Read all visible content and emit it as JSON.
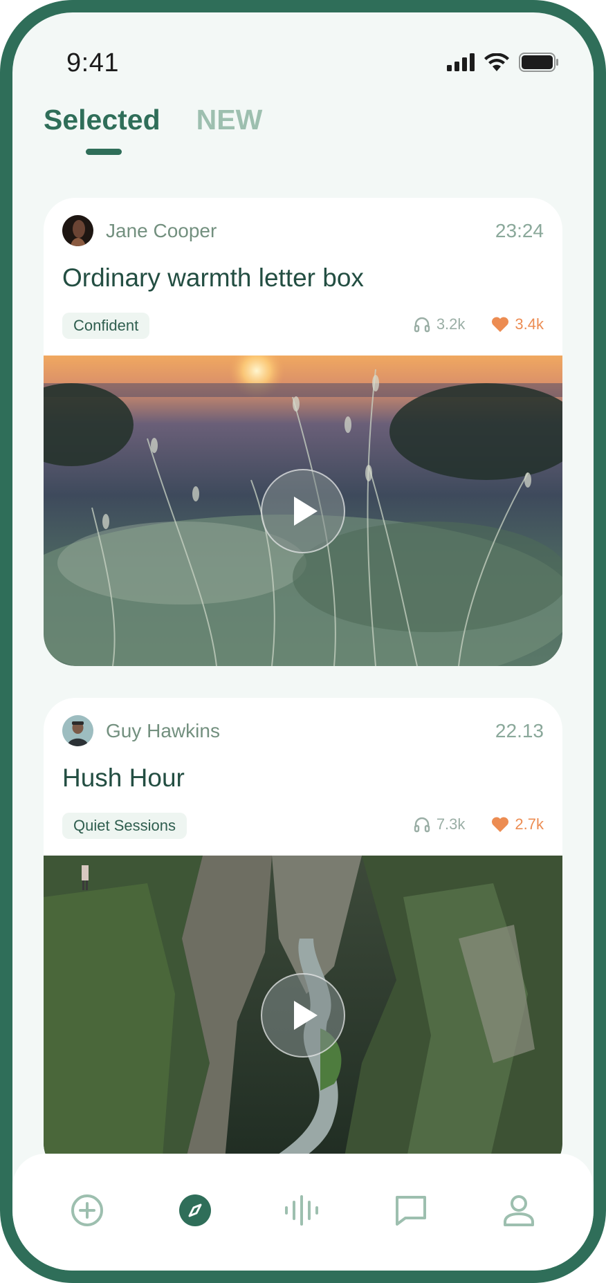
{
  "status_bar": {
    "time": "9:41"
  },
  "tabs": [
    {
      "label": "Selected",
      "active": true
    },
    {
      "label": "NEW",
      "active": false
    }
  ],
  "posts": [
    {
      "author": "Jane Cooper",
      "time": "23:24",
      "title": "Ordinary warmth letter box",
      "tag": "Confident",
      "listens": "3.2k",
      "likes": "3.4k",
      "media": "sunset-grass-image"
    },
    {
      "author": "Guy Hawkins",
      "time": "22.13",
      "title": "Hush Hour",
      "tag": "Quiet Sessions",
      "listens": "7.3k",
      "likes": "2.7k",
      "media": "canyon-river-image"
    }
  ],
  "bottom_nav": [
    {
      "icon": "add-circle-icon"
    },
    {
      "icon": "compass-icon",
      "active": true
    },
    {
      "icon": "waveform-icon"
    },
    {
      "icon": "chat-icon"
    },
    {
      "icon": "profile-icon"
    }
  ],
  "colors": {
    "brand": "#2f6e59",
    "inactive_tab": "#9dbfaf",
    "like": "#ec8c52",
    "background": "#f3f8f6"
  }
}
